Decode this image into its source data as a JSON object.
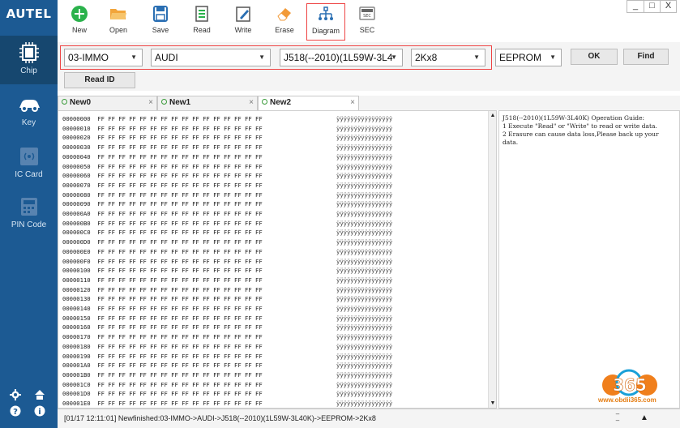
{
  "app": {
    "logo": "AUTEL"
  },
  "window_controls": {
    "minimize": "_",
    "maximize": "□",
    "close": "X"
  },
  "sidebar": {
    "items": [
      {
        "label": "Chip",
        "icon": "chip-icon",
        "active": true
      },
      {
        "label": "Key",
        "icon": "car-key-icon",
        "active": false
      },
      {
        "label": "IC Card",
        "icon": "ic-card-icon",
        "active": false
      },
      {
        "label": "PIN Code",
        "icon": "pin-code-icon",
        "active": false
      }
    ],
    "bottom_icons": [
      "gear-icon",
      "home-icon",
      "help-icon",
      "info-icon"
    ]
  },
  "toolbar": {
    "buttons": [
      {
        "label": "New",
        "icon": "new-icon"
      },
      {
        "label": "Open",
        "icon": "open-icon"
      },
      {
        "label": "Save",
        "icon": "save-icon"
      },
      {
        "label": "Read",
        "icon": "read-icon"
      },
      {
        "label": "Write",
        "icon": "write-icon"
      },
      {
        "label": "Erase",
        "icon": "erase-icon"
      },
      {
        "label": "Diagram",
        "icon": "diagram-icon",
        "selected": true
      },
      {
        "label": "SEC",
        "icon": "sec-icon"
      }
    ]
  },
  "selectors": {
    "category": "03-IMMO",
    "brand": "AUDI",
    "model": "J518(--2010)(1L59W-3L4",
    "size": "2Kx8",
    "chip_type": "EEPROM"
  },
  "buttons": {
    "ok": "OK",
    "find": "Find",
    "read_id": "Read ID"
  },
  "tabs": [
    {
      "label": "New0",
      "close": "×"
    },
    {
      "label": "New1",
      "close": "×"
    },
    {
      "label": "New2",
      "close": "×",
      "active": true
    }
  ],
  "hex": {
    "addresses": [
      "00000000",
      "00000010",
      "00000020",
      "00000030",
      "00000040",
      "00000050",
      "00000060",
      "00000070",
      "00000080",
      "00000090",
      "000000A0",
      "000000B0",
      "000000C0",
      "000000D0",
      "000000E0",
      "000000F0",
      "00000100",
      "00000110",
      "00000120",
      "00000130",
      "00000140",
      "00000150",
      "00000160",
      "00000170",
      "00000180",
      "00000190",
      "000001A0",
      "000001B0",
      "000001C0",
      "000001D0",
      "000001E0"
    ],
    "bytes": "FF FF FF FF FF FF FF FF FF FF FF FF FF FF FF FF",
    "ascii": "ÿÿÿÿÿÿÿÿÿÿÿÿÿÿÿÿ"
  },
  "guide": {
    "title": "J518(--2010)(1L59W-3L40K) Operation Guide:",
    "lines": [
      "1 Execute \"Read\" or \"Write\" to read or write data.",
      "2 Erasure can cause data loss,Please back up your data."
    ]
  },
  "status": {
    "text": "[01/17 12:11:01] Newfinished:03-IMMO->AUDI->J518(--2010)(1L59W-3L40K)->EEPROM->2Kx8"
  },
  "watermark": {
    "logo_text": "365",
    "url": "www.obdii365.com"
  },
  "colors": {
    "sidebar": "#1c5a93",
    "accent_green": "#2bb24c",
    "highlight_red": "#e44444"
  }
}
